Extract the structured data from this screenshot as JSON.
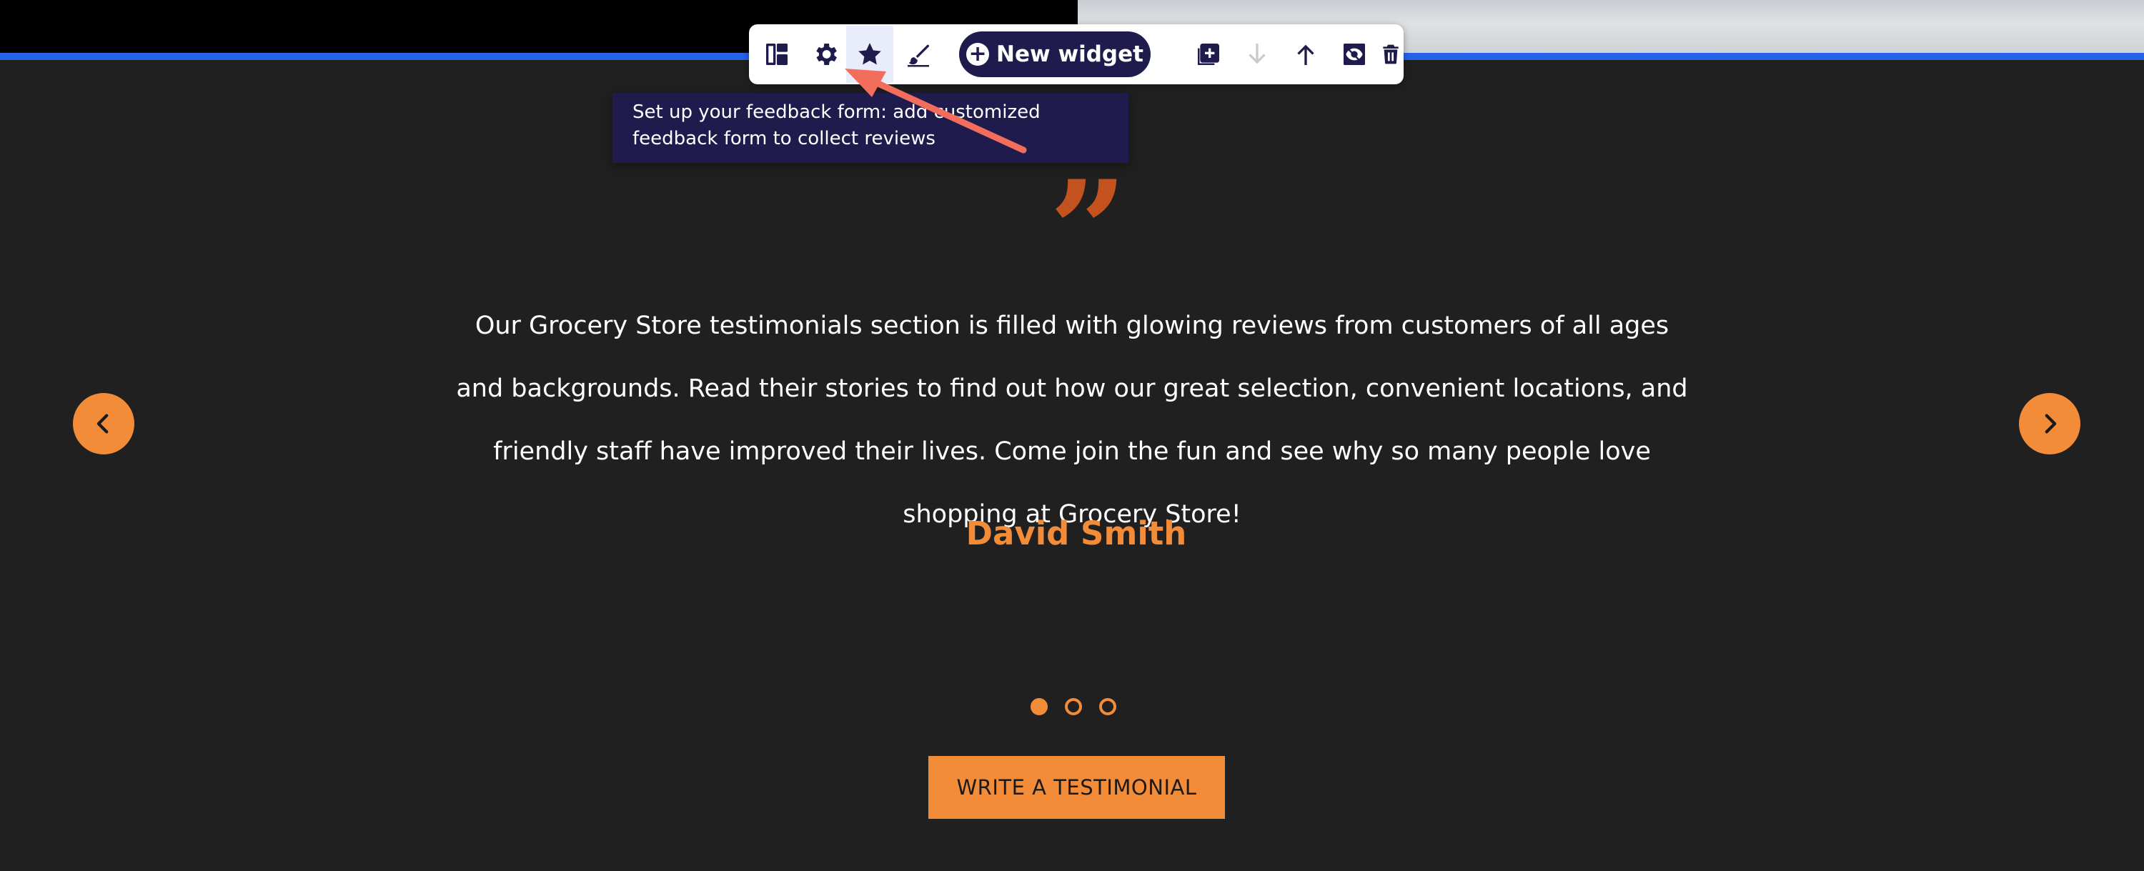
{
  "toolbar": {
    "items": [
      {
        "icon": "layout-icon"
      },
      {
        "icon": "gear-icon"
      },
      {
        "icon": "star-icon",
        "active": true
      },
      {
        "icon": "brush-icon"
      }
    ],
    "new_widget_label": "New widget",
    "right_items": [
      {
        "icon": "add-copy-icon"
      },
      {
        "icon": "arrow-down-icon",
        "disabled": true
      },
      {
        "icon": "arrow-up-icon"
      },
      {
        "icon": "hide-eye-icon"
      },
      {
        "icon": "trash-icon"
      }
    ]
  },
  "tooltip": {
    "text": "Set up your feedback form: add customized feedback form to collect reviews"
  },
  "testimonial": {
    "quote_mark": "”",
    "text": "Our Grocery Store testimonials section is filled with glowing reviews from customers of all ages and backgrounds. Read their stories to find out how our great selection, convenient locations, and friendly staff have improved their lives. Come join the fun and see why so many people love shopping at Grocery Store!",
    "author": "David Smith"
  },
  "slider": {
    "active_index": 0,
    "count": 3
  },
  "cta": {
    "label": "WRITE A TESTIMONIAL"
  },
  "colors": {
    "background": "#202020",
    "accent": "#f28c38",
    "quote": "#c4521f",
    "toolbar_dark": "#1f1b4d",
    "divider_blue": "#2563eb"
  }
}
